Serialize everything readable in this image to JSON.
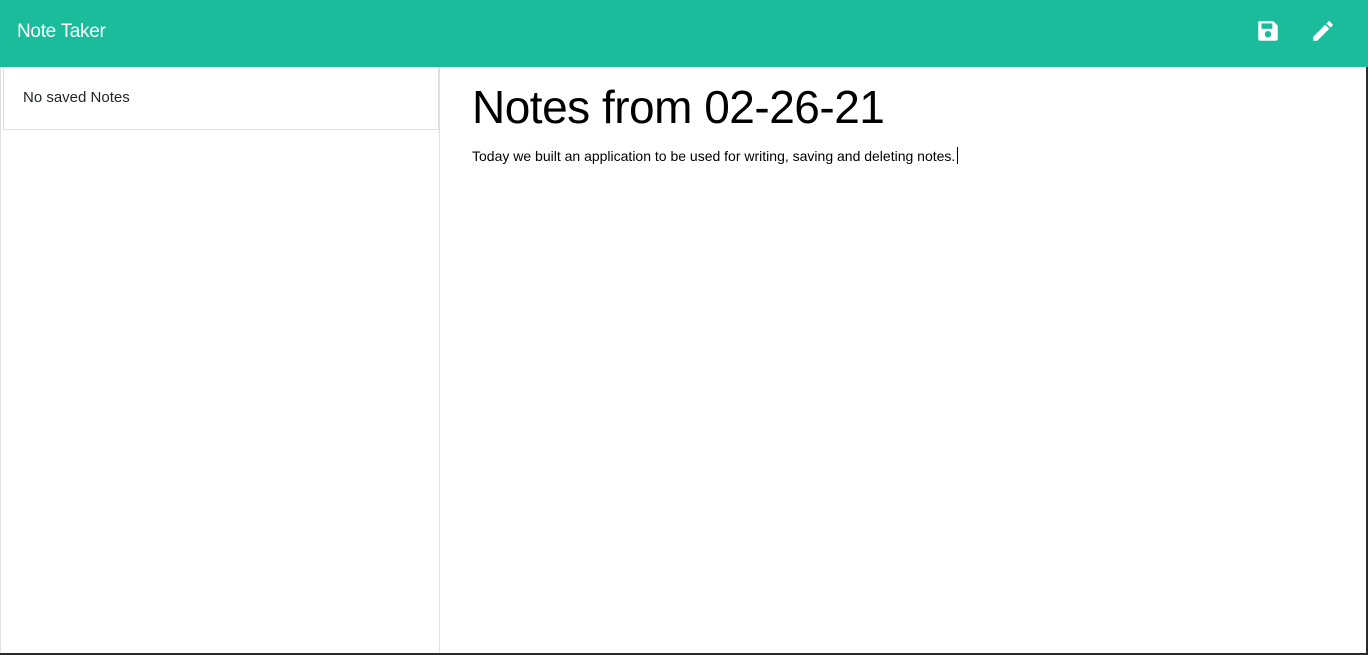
{
  "navbar": {
    "brand": "Note Taker",
    "background": "#1abc9c",
    "icons": [
      "save-icon",
      "pencil-icon"
    ]
  },
  "sidebar": {
    "empty_message": "No saved Notes"
  },
  "editor": {
    "title_value": "Notes from 02-26-21",
    "body_value": "Today we built an application to be used for writing, saving and deleting notes."
  }
}
